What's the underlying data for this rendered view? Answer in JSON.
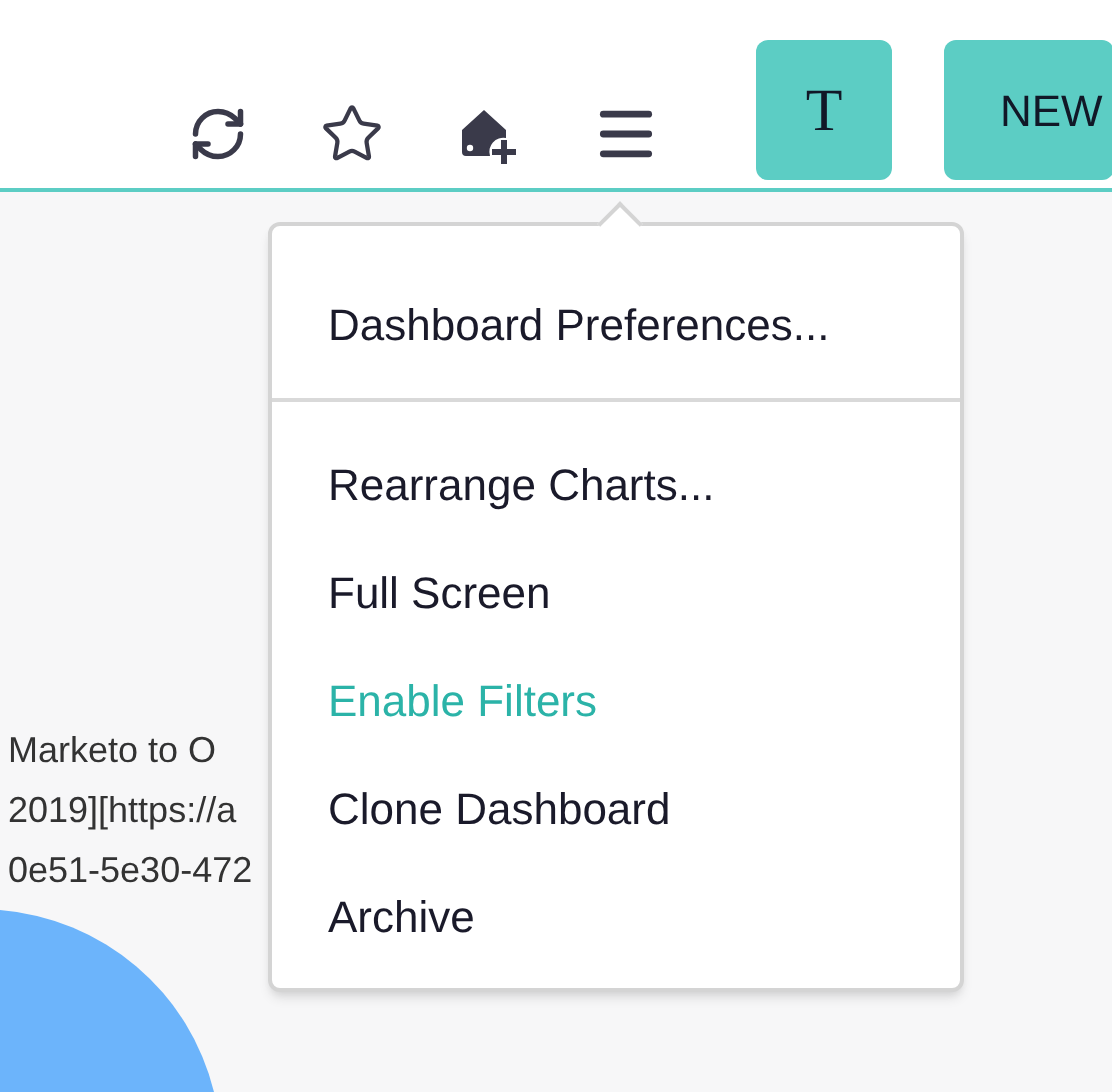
{
  "header": {
    "buttons": [
      {
        "label": "T",
        "kind": "serif"
      },
      {
        "label": "NEW",
        "kind": "sans"
      }
    ]
  },
  "background_text": [
    "Marketo to O",
    "2019][https://a",
    "0e51-5e30-472"
  ],
  "menu": {
    "sections": [
      {
        "items": [
          {
            "label": "Dashboard Preferences...",
            "active": false
          }
        ]
      },
      {
        "items": [
          {
            "label": "Rearrange Charts...",
            "active": false
          },
          {
            "label": "Full Screen",
            "active": false
          },
          {
            "label": "Enable Filters",
            "active": true
          },
          {
            "label": "Clone Dashboard",
            "active": false
          },
          {
            "label": "Archive",
            "active": false
          }
        ]
      }
    ]
  }
}
